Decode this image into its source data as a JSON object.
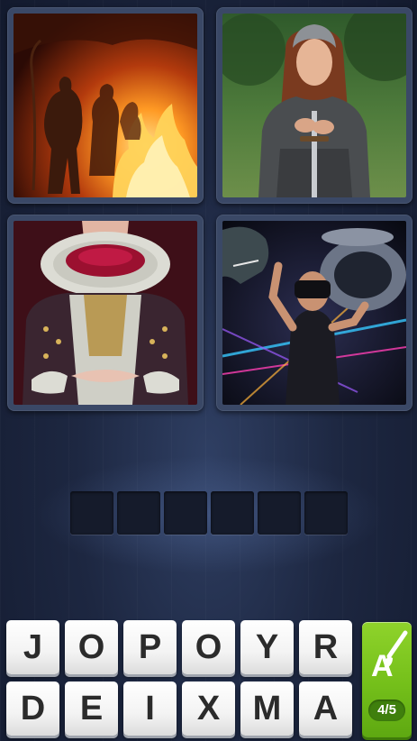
{
  "photos": [
    {
      "name": "cavemen-fire-photo",
      "subject": "cavemen around a fire"
    },
    {
      "name": "chainmail-warrior-photo",
      "subject": "woman in chainmail with sword"
    },
    {
      "name": "elizabethan-queen-photo",
      "subject": "woman in Elizabethan ruff costume"
    },
    {
      "name": "vr-headset-photo",
      "subject": "man with VR headset"
    }
  ],
  "answer": {
    "slots": [
      "",
      "",
      "",
      "",
      "",
      ""
    ]
  },
  "keyboard": {
    "row1": [
      "J",
      "O",
      "P",
      "O",
      "Y",
      "R"
    ],
    "row2": [
      "D",
      "E",
      "I",
      "X",
      "M",
      "A"
    ]
  },
  "hint": {
    "icon": "brush-icon",
    "letter_icon": "A",
    "counter": "4/5"
  },
  "colors": {
    "background": "#1d2741",
    "tile": "#f3f3f3",
    "hint_green": "#74bf1a"
  }
}
